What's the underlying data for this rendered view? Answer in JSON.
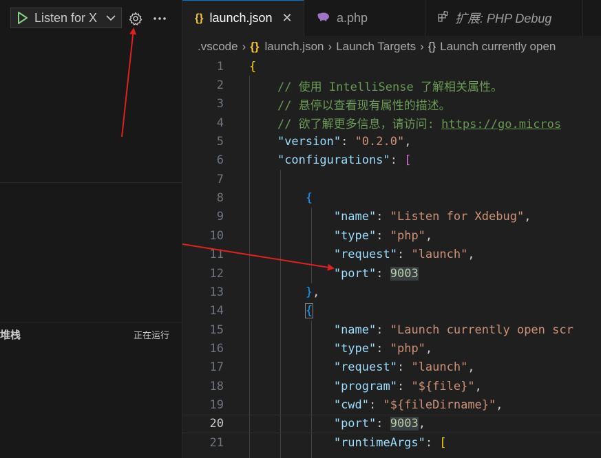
{
  "debug": {
    "config_label": "Listen for X",
    "call_stack_title": "堆栈",
    "call_stack_status": "正在运行"
  },
  "tabs": [
    {
      "label": "launch.json",
      "icon": "{}",
      "active": true
    },
    {
      "label": "a.php",
      "icon": "php-elephant"
    },
    {
      "label": "扩展: PHP Debug",
      "icon": "extensions"
    }
  ],
  "breadcrumb": [
    ".vscode",
    "launch.json",
    "Launch Targets",
    "Launch currently open"
  ],
  "code_lines": [
    {
      "n": "1",
      "tokens": [
        [
          "b1",
          "{"
        ]
      ]
    },
    {
      "n": "2",
      "tokens": [
        [
          "sp",
          "    "
        ],
        [
          "com",
          "// 使用 IntelliSense 了解相关属性。"
        ]
      ]
    },
    {
      "n": "3",
      "tokens": [
        [
          "sp",
          "    "
        ],
        [
          "com",
          "// 悬停以查看现有属性的描述。"
        ]
      ]
    },
    {
      "n": "4",
      "tokens": [
        [
          "sp",
          "    "
        ],
        [
          "com",
          "// 欲了解更多信息，请访问: "
        ],
        [
          "link",
          "https://go.micros"
        ]
      ]
    },
    {
      "n": "5",
      "tokens": [
        [
          "sp",
          "    "
        ],
        [
          "key",
          "\"version\""
        ],
        [
          "p",
          ": "
        ],
        [
          "str",
          "\"0.2.0\""
        ],
        [
          "p",
          ","
        ]
      ]
    },
    {
      "n": "6",
      "tokens": [
        [
          "sp",
          "    "
        ],
        [
          "key",
          "\"configurations\""
        ],
        [
          "p",
          ": "
        ],
        [
          "b2",
          "["
        ]
      ]
    },
    {
      "n": "7",
      "tokens": []
    },
    {
      "n": "8",
      "tokens": [
        [
          "sp",
          "        "
        ],
        [
          "b3",
          "{"
        ]
      ]
    },
    {
      "n": "9",
      "tokens": [
        [
          "sp",
          "            "
        ],
        [
          "key",
          "\"name\""
        ],
        [
          "p",
          ": "
        ],
        [
          "str",
          "\"Listen for Xdebug\""
        ],
        [
          "p",
          ","
        ]
      ]
    },
    {
      "n": "10",
      "tokens": [
        [
          "sp",
          "            "
        ],
        [
          "key",
          "\"type\""
        ],
        [
          "p",
          ": "
        ],
        [
          "str",
          "\"php\""
        ],
        [
          "p",
          ","
        ]
      ]
    },
    {
      "n": "11",
      "tokens": [
        [
          "sp",
          "            "
        ],
        [
          "key",
          "\"request\""
        ],
        [
          "p",
          ": "
        ],
        [
          "str",
          "\"launch\""
        ],
        [
          "p",
          ","
        ]
      ]
    },
    {
      "n": "12",
      "tokens": [
        [
          "sp",
          "            "
        ],
        [
          "key",
          "\"port\""
        ],
        [
          "p",
          ": "
        ],
        [
          "num",
          "9003"
        ]
      ]
    },
    {
      "n": "13",
      "tokens": [
        [
          "sp",
          "        "
        ],
        [
          "b3",
          "}"
        ],
        [
          "p",
          ","
        ]
      ]
    },
    {
      "n": "14",
      "tokens": [
        [
          "sp",
          "        "
        ],
        [
          "b3box",
          "{"
        ]
      ]
    },
    {
      "n": "15",
      "tokens": [
        [
          "sp",
          "            "
        ],
        [
          "key",
          "\"name\""
        ],
        [
          "p",
          ": "
        ],
        [
          "str",
          "\"Launch currently open scr"
        ]
      ]
    },
    {
      "n": "16",
      "tokens": [
        [
          "sp",
          "            "
        ],
        [
          "key",
          "\"type\""
        ],
        [
          "p",
          ": "
        ],
        [
          "str",
          "\"php\""
        ],
        [
          "p",
          ","
        ]
      ]
    },
    {
      "n": "17",
      "tokens": [
        [
          "sp",
          "            "
        ],
        [
          "key",
          "\"request\""
        ],
        [
          "p",
          ": "
        ],
        [
          "str",
          "\"launch\""
        ],
        [
          "p",
          ","
        ]
      ]
    },
    {
      "n": "18",
      "tokens": [
        [
          "sp",
          "            "
        ],
        [
          "key",
          "\"program\""
        ],
        [
          "p",
          ": "
        ],
        [
          "str",
          "\"${file}\""
        ],
        [
          "p",
          ","
        ]
      ]
    },
    {
      "n": "19",
      "tokens": [
        [
          "sp",
          "            "
        ],
        [
          "key",
          "\"cwd\""
        ],
        [
          "p",
          ": "
        ],
        [
          "str",
          "\"${fileDirname}\""
        ],
        [
          "p",
          ","
        ]
      ]
    },
    {
      "n": "20",
      "tokens": [
        [
          "sp",
          "            "
        ],
        [
          "key",
          "\"port\""
        ],
        [
          "p",
          ": "
        ],
        [
          "num",
          "9003"
        ],
        [
          "p",
          ","
        ]
      ],
      "current": true
    },
    {
      "n": "21",
      "tokens": [
        [
          "sp",
          "            "
        ],
        [
          "key",
          "\"runtimeArgs\""
        ],
        [
          "p",
          ": "
        ],
        [
          "b1",
          "["
        ]
      ]
    }
  ]
}
